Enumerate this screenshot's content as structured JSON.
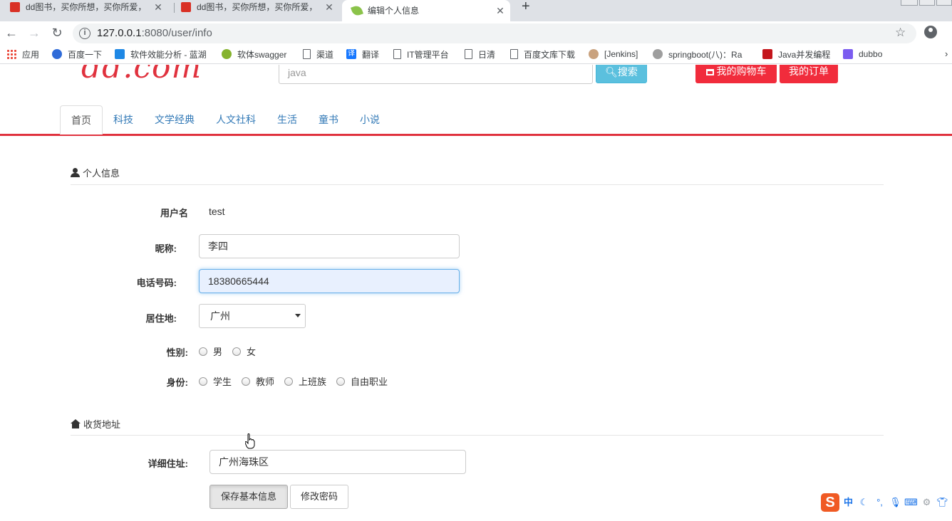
{
  "browser": {
    "tabs": [
      {
        "title": "dd图书，买你所想，买你所爱，",
        "active": false
      },
      {
        "title": "dd图书，买你所想，买你所爱，",
        "active": false
      },
      {
        "title": "编辑个人信息",
        "active": true
      }
    ],
    "url_host": "127.0.0.1",
    "url_path": ":8080/user/info",
    "bookmarks": [
      {
        "label": "应用",
        "icon": "apps-grid-icon"
      },
      {
        "label": "百度一下",
        "icon": "baidu-paw-icon"
      },
      {
        "label": "软件效能分析 - 蓝湖",
        "icon": "lanhu-icon"
      },
      {
        "label": "软体swagger",
        "icon": "swagger-icon"
      },
      {
        "label": "渠道",
        "icon": "page-icon"
      },
      {
        "label": "翻译",
        "icon": "translate-icon"
      },
      {
        "label": "IT管理平台",
        "icon": "page-icon"
      },
      {
        "label": "日清",
        "icon": "page-icon"
      },
      {
        "label": "百度文库下载",
        "icon": "page-icon"
      },
      {
        "label": "[Jenkins]",
        "icon": "jenkins-icon"
      },
      {
        "label": "springboot(八)：Ra",
        "icon": "springboot-icon"
      },
      {
        "label": "Java并发编程",
        "icon": "csdn-icon"
      },
      {
        "label": "dubbo",
        "icon": "dubbo-icon"
      }
    ],
    "bookmarks_more": "›"
  },
  "header": {
    "logo": "dd.com",
    "search_placeholder": "java",
    "search_button": "搜索",
    "cart_button": "我的购物车",
    "orders_button": "我的订单"
  },
  "nav": {
    "tabs": [
      "首页",
      "科技",
      "文学经典",
      "人文社科",
      "生活",
      "童书",
      "小说"
    ],
    "active_index": 0
  },
  "profile": {
    "section_title": "个人信息",
    "username_label": "用户名",
    "username_value": "test",
    "nickname_label": "昵称:",
    "nickname_value": "李四",
    "phone_label": "电话号码:",
    "phone_value": "18380665444",
    "residence_label": "居住地:",
    "residence_value": "广州",
    "gender_label": "性别:",
    "gender_options": [
      "男",
      "女"
    ],
    "identity_label": "身份:",
    "identity_options": [
      "学生",
      "教师",
      "上班族",
      "自由职业"
    ]
  },
  "address": {
    "section_title": "收货地址",
    "detail_label": "详细住址:",
    "detail_value": "广州海珠区"
  },
  "actions": {
    "save_button": "保存基本信息",
    "change_password_button": "修改密码"
  },
  "ime": {
    "logo": "S",
    "mode": "中"
  },
  "colors": {
    "brand_red": "#e0323e",
    "button_red": "#f12c3c",
    "search_blue": "#5bc0de",
    "link_blue": "#337ab7"
  }
}
